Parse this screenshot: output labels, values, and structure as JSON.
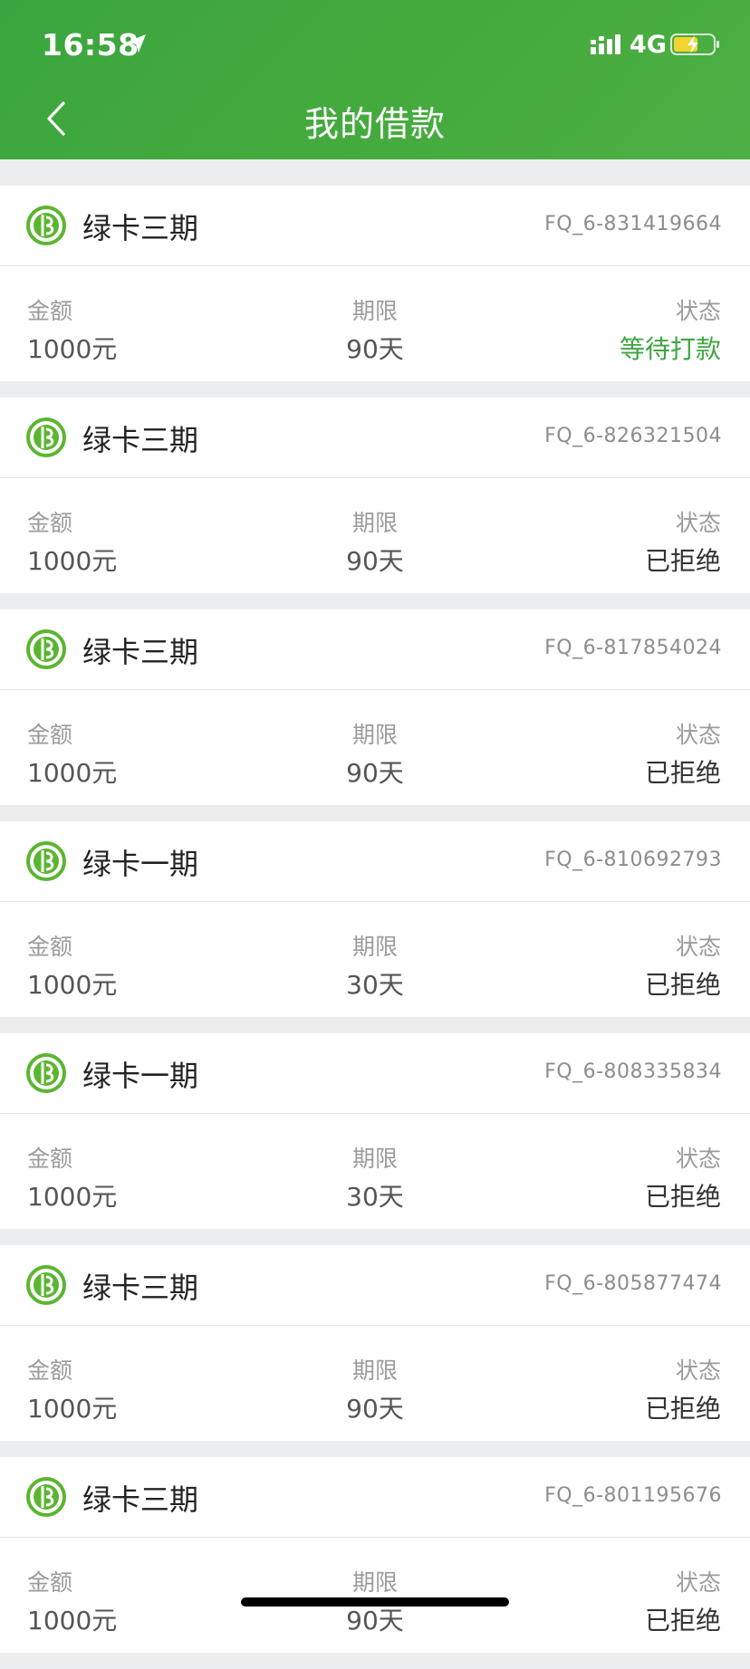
{
  "status_bar": {
    "time": "16:58",
    "network": "4G",
    "location_icon": "location-arrow-icon",
    "signal_icon": "signal-bars-icon",
    "battery_icon": "battery-charging-icon"
  },
  "nav": {
    "title": "我的借款",
    "back_icon": "chevron-left-icon"
  },
  "colors": {
    "header_green": "#3aa53e",
    "status_pending": "#3ea640",
    "product_icon_green": "#5cb531"
  },
  "labels": {
    "amount": "金额",
    "term": "期限",
    "status": "状态"
  },
  "loans": [
    {
      "product": "绿卡三期",
      "id": "FQ_6-831419664",
      "amount": "1000元",
      "term": "90天",
      "status": "等待打款",
      "status_type": "pending"
    },
    {
      "product": "绿卡三期",
      "id": "FQ_6-826321504",
      "amount": "1000元",
      "term": "90天",
      "status": "已拒绝",
      "status_type": "rejected"
    },
    {
      "product": "绿卡三期",
      "id": "FQ_6-817854024",
      "amount": "1000元",
      "term": "90天",
      "status": "已拒绝",
      "status_type": "rejected"
    },
    {
      "product": "绿卡一期",
      "id": "FQ_6-810692793",
      "amount": "1000元",
      "term": "30天",
      "status": "已拒绝",
      "status_type": "rejected"
    },
    {
      "product": "绿卡一期",
      "id": "FQ_6-808335834",
      "amount": "1000元",
      "term": "30天",
      "status": "已拒绝",
      "status_type": "rejected"
    },
    {
      "product": "绿卡三期",
      "id": "FQ_6-805877474",
      "amount": "1000元",
      "term": "90天",
      "status": "已拒绝",
      "status_type": "rejected"
    },
    {
      "product": "绿卡三期",
      "id": "FQ_6-801195676",
      "amount": "1000元",
      "term": "90天",
      "status": "已拒绝",
      "status_type": "rejected"
    }
  ]
}
